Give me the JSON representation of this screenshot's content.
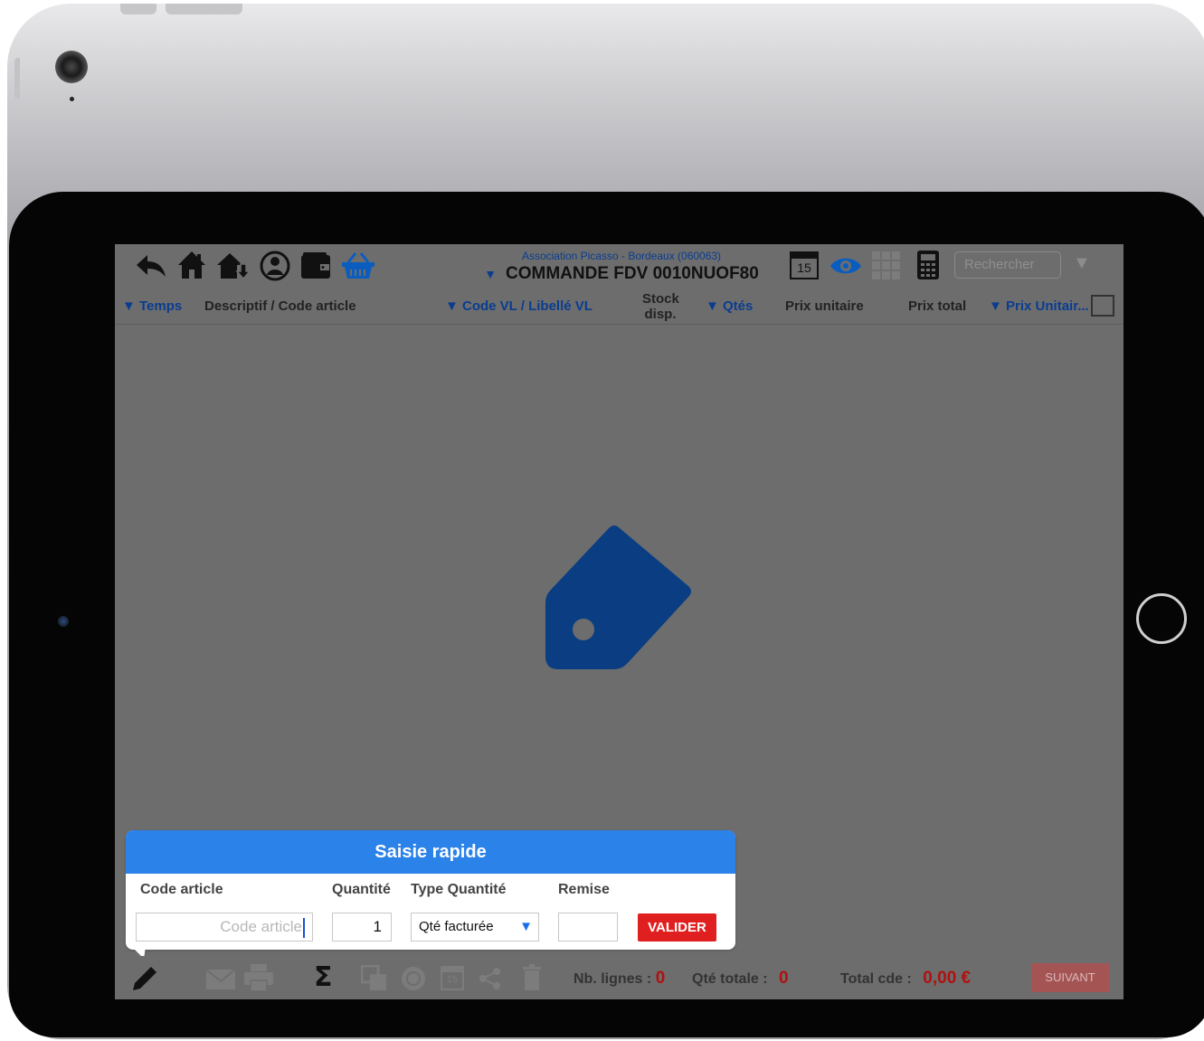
{
  "toolbar": {
    "client_label": "Association Picasso - Bordeaux (060063)",
    "order_title": "COMMANDE FDV 0010NUOF80",
    "order_dropdown": "▼",
    "calendar_day": "15",
    "search_placeholder": "Rechercher",
    "filter_dropdown": "▼"
  },
  "columns": {
    "temps": "▼ Temps",
    "descriptif": "Descriptif / Code article",
    "code_vl": "▼ Code VL / Libellé VL",
    "stock_line1": "Stock",
    "stock_line2": "disp.",
    "qtes": "▼ Qtés",
    "prix_unitaire": "Prix unitaire",
    "prix_total": "Prix total",
    "prix_unitair2": "▼ Prix Unitair..."
  },
  "quick_entry": {
    "title": "Saisie rapide",
    "code_label": "Code article",
    "code_placeholder": "Code article",
    "quantity_label": "Quantité",
    "quantity_value": "1",
    "type_label": "Type Quantité",
    "type_value": "Qté facturée",
    "type_arrow": "▼",
    "discount_label": "Remise",
    "discount_value": "",
    "submit_label": "VALIDER"
  },
  "footer": {
    "calendar_day": "15",
    "lines_label": "Nb. lignes :",
    "lines_value": "0",
    "qty_label": "Qté totale :",
    "qty_value": "0",
    "total_label": "Total cde :",
    "total_value": "0,00 €",
    "next_label": "SUIVANT"
  },
  "colors": {
    "accent_blue": "#0a3d8f",
    "popup_header": "#2b82e8",
    "validate_red": "#e02020",
    "value_red": "#b01010",
    "screen_bg": "#6d6d6d"
  }
}
